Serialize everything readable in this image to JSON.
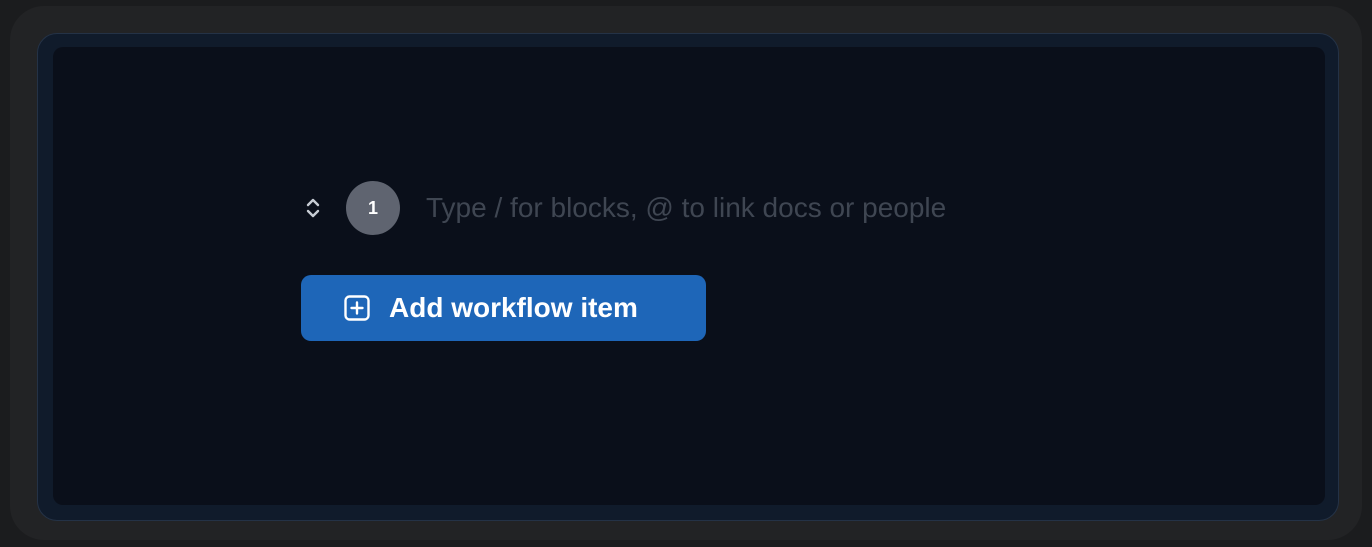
{
  "workflow": {
    "items": [
      {
        "number": "1",
        "placeholder": "Type / for blocks, @ to link docs or people",
        "value": ""
      }
    ],
    "add_button_label": "Add workflow item"
  },
  "icons": {
    "reorder": "chevron-up-down-icon",
    "add": "plus-square-icon"
  },
  "colors": {
    "accent": "#1e66b8",
    "step_badge": "#5f6470",
    "panel_background": "#0a0f1a"
  }
}
